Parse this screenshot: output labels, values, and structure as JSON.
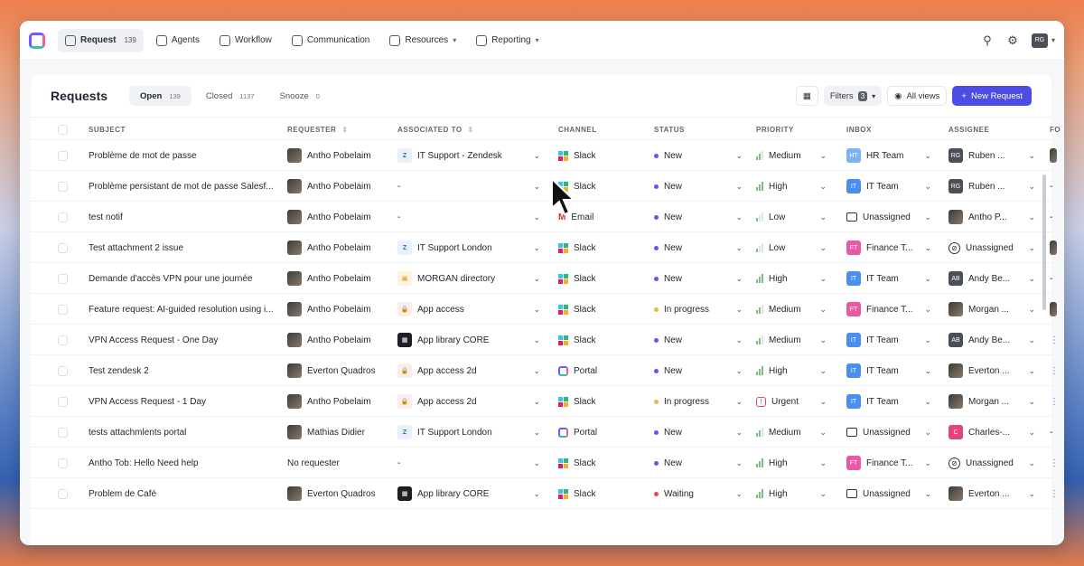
{
  "nav": {
    "items": [
      {
        "label": "Request",
        "count": "139",
        "icon": "inbox-icon",
        "active": true
      },
      {
        "label": "Agents",
        "icon": "ai-icon"
      },
      {
        "label": "Workflow",
        "icon": "workflow-icon"
      },
      {
        "label": "Communication",
        "icon": "megaphone-icon"
      },
      {
        "label": "Resources",
        "icon": "layers-icon",
        "dropdown": true
      },
      {
        "label": "Reporting",
        "icon": "chart-icon",
        "dropdown": true
      }
    ],
    "user_initials": "RG"
  },
  "panel": {
    "title": "Requests",
    "tabs": [
      {
        "label": "Open",
        "count": "139",
        "active": true
      },
      {
        "label": "Closed",
        "count": "1137"
      },
      {
        "label": "Snooze",
        "count": "0"
      }
    ],
    "filters_label": "Filters",
    "filters_count": "3",
    "all_views_label": "All views",
    "new_request_label": "New Request"
  },
  "columns": [
    "SUBJECT",
    "REQUESTER",
    "ASSOCIATED TO",
    "CHANNEL",
    "STATUS",
    "PRIORITY",
    "INBOX",
    "ASSIGNEE",
    "FO"
  ],
  "colors": {
    "accent": "#4d4ce6",
    "new": "#5b5be8",
    "in_progress": "#e7b84a",
    "waiting": "#e5485d"
  },
  "rows": [
    {
      "subject": "Problème de mot de passe",
      "requester": "Antho Pobelaim",
      "assoc": "IT Support - Zendesk",
      "assoc_icon": "zendesk",
      "channel": "Slack",
      "status": "New",
      "priority": "Medium",
      "inbox": "HR Team",
      "inbox_init": "HT",
      "inbox_color": "#7db3f5",
      "assignee": "Ruben ...",
      "assignee_init": "RG",
      "extra": "photo"
    },
    {
      "subject": "Problème persistant de mot de passe Salesf...",
      "requester": "Antho Pobelaim",
      "assoc": "-",
      "channel": "Slack",
      "status": "New",
      "priority": "High",
      "inbox": "IT Team",
      "inbox_init": "IT",
      "inbox_color": "#4a8ff0",
      "assignee": "Ruben ...",
      "assignee_init": "RG",
      "extra": "-"
    },
    {
      "subject": "test notif",
      "requester": "Antho Pobelaim",
      "assoc": "-",
      "channel": "Email",
      "status": "New",
      "priority": "Low",
      "inbox": "Unassigned",
      "inbox_init": "",
      "inbox_color": "",
      "assignee": "Antho P...",
      "assignee_init": "photo",
      "extra": "-"
    },
    {
      "subject": "Test attachment 2 issue",
      "requester": "Antho Pobelaim",
      "assoc": "IT Support London",
      "assoc_icon": "zendesk",
      "channel": "Slack",
      "status": "New",
      "priority": "Low",
      "inbox": "Finance T...",
      "inbox_init": "FT",
      "inbox_color": "#e85aa8",
      "assignee": "Unassigned",
      "assignee_init": "none",
      "extra": "photo"
    },
    {
      "subject": "Demande d'accès VPN pour une journée",
      "requester": "Antho Pobelaim",
      "assoc": "MORGAN directory",
      "assoc_icon": "dir",
      "channel": "Slack",
      "status": "New",
      "priority": "High",
      "inbox": "IT Team",
      "inbox_init": "IT",
      "inbox_color": "#4a8ff0",
      "assignee": "Andy Be...",
      "assignee_init": "AB",
      "extra": "-"
    },
    {
      "subject": "Feature request: AI-guided resolution using i...",
      "requester": "Antho Pobelaim",
      "assoc": "App access",
      "assoc_icon": "lock",
      "channel": "Slack",
      "status": "In progress",
      "priority": "Medium",
      "inbox": "Finance T...",
      "inbox_init": "FT",
      "inbox_color": "#e85aa8",
      "assignee": "Morgan ...",
      "assignee_init": "photo",
      "extra": "photo"
    },
    {
      "subject": "VPN Access Request - One Day",
      "requester": "Antho Pobelaim",
      "assoc": "App library CORE",
      "assoc_icon": "grid",
      "channel": "Slack",
      "status": "New",
      "priority": "Medium",
      "inbox": "IT Team",
      "inbox_init": "IT",
      "inbox_color": "#4a8ff0",
      "assignee": "Andy Be...",
      "assignee_init": "AB",
      "extra": "dots"
    },
    {
      "subject": "Test zendesk 2",
      "requester": "Everton Quadros",
      "assoc": "App access 2d",
      "assoc_icon": "lock",
      "channel": "Portal",
      "status": "New",
      "priority": "High",
      "inbox": "IT Team",
      "inbox_init": "IT",
      "inbox_color": "#4a8ff0",
      "assignee": "Everton ...",
      "assignee_init": "photo",
      "extra": "dots"
    },
    {
      "subject": "VPN Access Request - 1 Day",
      "requester": "Antho Pobelaim",
      "assoc": "App access 2d",
      "assoc_icon": "lock",
      "channel": "Slack",
      "status": "In progress",
      "priority": "Urgent",
      "inbox": "IT Team",
      "inbox_init": "IT",
      "inbox_color": "#4a8ff0",
      "assignee": "Morgan ...",
      "assignee_init": "photo",
      "extra": "dots"
    },
    {
      "subject": "tests attachmlents portal",
      "requester": "Mathias Didier",
      "assoc": "IT Support London",
      "assoc_icon": "zendesk",
      "channel": "Portal",
      "status": "New",
      "priority": "Medium",
      "inbox": "Unassigned",
      "inbox_init": "",
      "inbox_color": "",
      "assignee": "Charles-...",
      "assignee_init": "C",
      "extra": "-"
    },
    {
      "subject": "Antho Tob: Hello Need help",
      "requester": "No requester",
      "assoc": "-",
      "channel": "Slack",
      "status": "New",
      "priority": "High",
      "inbox": "Finance T...",
      "inbox_init": "FT",
      "inbox_color": "#e85aa8",
      "assignee": "Unassigned",
      "assignee_init": "none",
      "extra": "dots"
    },
    {
      "subject": "Problem de Café",
      "requester": "Everton Quadros",
      "assoc": "App library CORE",
      "assoc_icon": "grid",
      "channel": "Slack",
      "status": "Waiting",
      "priority": "High",
      "inbox": "Unassigned",
      "inbox_init": "",
      "inbox_color": "",
      "assignee": "Everton ...",
      "assignee_init": "photo",
      "extra": "dots"
    }
  ]
}
